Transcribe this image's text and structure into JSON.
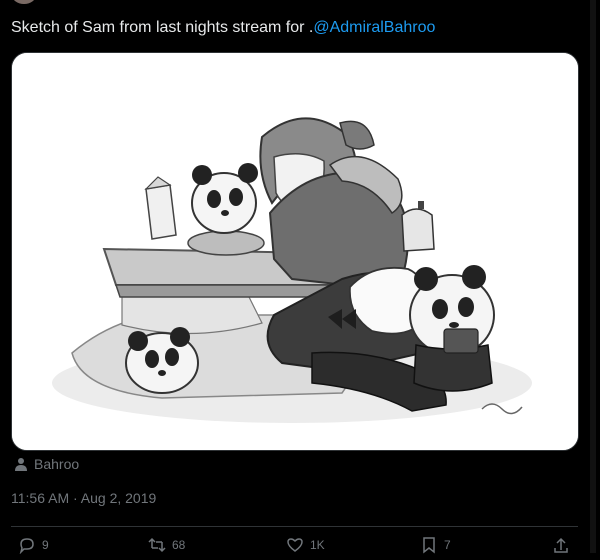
{
  "tweet": {
    "text_prefix": "Sketch of Sam from last nights stream for .",
    "mention": "@AdmiralBahroo"
  },
  "media": {
    "alt": "Sketch of Sam"
  },
  "artist": {
    "icon": "person-icon",
    "name": "Bahroo"
  },
  "timestamp": "11:56 AM · Aug 2, 2019",
  "actions": {
    "reply": {
      "icon": "reply-icon",
      "count": "9"
    },
    "retweet": {
      "icon": "retweet-icon",
      "count": "68"
    },
    "like": {
      "icon": "heart-icon",
      "count": "1K"
    },
    "bookmark": {
      "icon": "bookmark-icon",
      "count": "7"
    },
    "share": {
      "icon": "share-icon"
    }
  },
  "colors": {
    "background": "#000000",
    "text": "#e7e9ea",
    "muted": "#71767b",
    "link": "#1d9bf0",
    "border": "#2f3336"
  }
}
